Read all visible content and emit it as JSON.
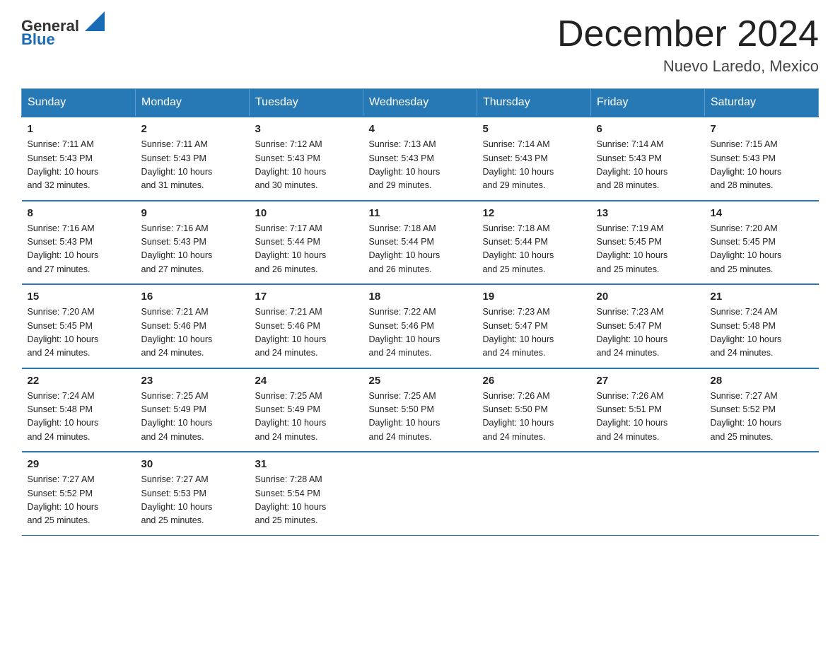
{
  "header": {
    "logo_general": "General",
    "logo_blue": "Blue",
    "month_title": "December 2024",
    "location": "Nuevo Laredo, Mexico"
  },
  "weekdays": [
    "Sunday",
    "Monday",
    "Tuesday",
    "Wednesday",
    "Thursday",
    "Friday",
    "Saturday"
  ],
  "weeks": [
    [
      {
        "day": "1",
        "sunrise": "7:11 AM",
        "sunset": "5:43 PM",
        "daylight": "10 hours and 32 minutes."
      },
      {
        "day": "2",
        "sunrise": "7:11 AM",
        "sunset": "5:43 PM",
        "daylight": "10 hours and 31 minutes."
      },
      {
        "day": "3",
        "sunrise": "7:12 AM",
        "sunset": "5:43 PM",
        "daylight": "10 hours and 30 minutes."
      },
      {
        "day": "4",
        "sunrise": "7:13 AM",
        "sunset": "5:43 PM",
        "daylight": "10 hours and 29 minutes."
      },
      {
        "day": "5",
        "sunrise": "7:14 AM",
        "sunset": "5:43 PM",
        "daylight": "10 hours and 29 minutes."
      },
      {
        "day": "6",
        "sunrise": "7:14 AM",
        "sunset": "5:43 PM",
        "daylight": "10 hours and 28 minutes."
      },
      {
        "day": "7",
        "sunrise": "7:15 AM",
        "sunset": "5:43 PM",
        "daylight": "10 hours and 28 minutes."
      }
    ],
    [
      {
        "day": "8",
        "sunrise": "7:16 AM",
        "sunset": "5:43 PM",
        "daylight": "10 hours and 27 minutes."
      },
      {
        "day": "9",
        "sunrise": "7:16 AM",
        "sunset": "5:43 PM",
        "daylight": "10 hours and 27 minutes."
      },
      {
        "day": "10",
        "sunrise": "7:17 AM",
        "sunset": "5:44 PM",
        "daylight": "10 hours and 26 minutes."
      },
      {
        "day": "11",
        "sunrise": "7:18 AM",
        "sunset": "5:44 PM",
        "daylight": "10 hours and 26 minutes."
      },
      {
        "day": "12",
        "sunrise": "7:18 AM",
        "sunset": "5:44 PM",
        "daylight": "10 hours and 25 minutes."
      },
      {
        "day": "13",
        "sunrise": "7:19 AM",
        "sunset": "5:45 PM",
        "daylight": "10 hours and 25 minutes."
      },
      {
        "day": "14",
        "sunrise": "7:20 AM",
        "sunset": "5:45 PM",
        "daylight": "10 hours and 25 minutes."
      }
    ],
    [
      {
        "day": "15",
        "sunrise": "7:20 AM",
        "sunset": "5:45 PM",
        "daylight": "10 hours and 24 minutes."
      },
      {
        "day": "16",
        "sunrise": "7:21 AM",
        "sunset": "5:46 PM",
        "daylight": "10 hours and 24 minutes."
      },
      {
        "day": "17",
        "sunrise": "7:21 AM",
        "sunset": "5:46 PM",
        "daylight": "10 hours and 24 minutes."
      },
      {
        "day": "18",
        "sunrise": "7:22 AM",
        "sunset": "5:46 PM",
        "daylight": "10 hours and 24 minutes."
      },
      {
        "day": "19",
        "sunrise": "7:23 AM",
        "sunset": "5:47 PM",
        "daylight": "10 hours and 24 minutes."
      },
      {
        "day": "20",
        "sunrise": "7:23 AM",
        "sunset": "5:47 PM",
        "daylight": "10 hours and 24 minutes."
      },
      {
        "day": "21",
        "sunrise": "7:24 AM",
        "sunset": "5:48 PM",
        "daylight": "10 hours and 24 minutes."
      }
    ],
    [
      {
        "day": "22",
        "sunrise": "7:24 AM",
        "sunset": "5:48 PM",
        "daylight": "10 hours and 24 minutes."
      },
      {
        "day": "23",
        "sunrise": "7:25 AM",
        "sunset": "5:49 PM",
        "daylight": "10 hours and 24 minutes."
      },
      {
        "day": "24",
        "sunrise": "7:25 AM",
        "sunset": "5:49 PM",
        "daylight": "10 hours and 24 minutes."
      },
      {
        "day": "25",
        "sunrise": "7:25 AM",
        "sunset": "5:50 PM",
        "daylight": "10 hours and 24 minutes."
      },
      {
        "day": "26",
        "sunrise": "7:26 AM",
        "sunset": "5:50 PM",
        "daylight": "10 hours and 24 minutes."
      },
      {
        "day": "27",
        "sunrise": "7:26 AM",
        "sunset": "5:51 PM",
        "daylight": "10 hours and 24 minutes."
      },
      {
        "day": "28",
        "sunrise": "7:27 AM",
        "sunset": "5:52 PM",
        "daylight": "10 hours and 25 minutes."
      }
    ],
    [
      {
        "day": "29",
        "sunrise": "7:27 AM",
        "sunset": "5:52 PM",
        "daylight": "10 hours and 25 minutes."
      },
      {
        "day": "30",
        "sunrise": "7:27 AM",
        "sunset": "5:53 PM",
        "daylight": "10 hours and 25 minutes."
      },
      {
        "day": "31",
        "sunrise": "7:28 AM",
        "sunset": "5:54 PM",
        "daylight": "10 hours and 25 minutes."
      },
      null,
      null,
      null,
      null
    ]
  ]
}
